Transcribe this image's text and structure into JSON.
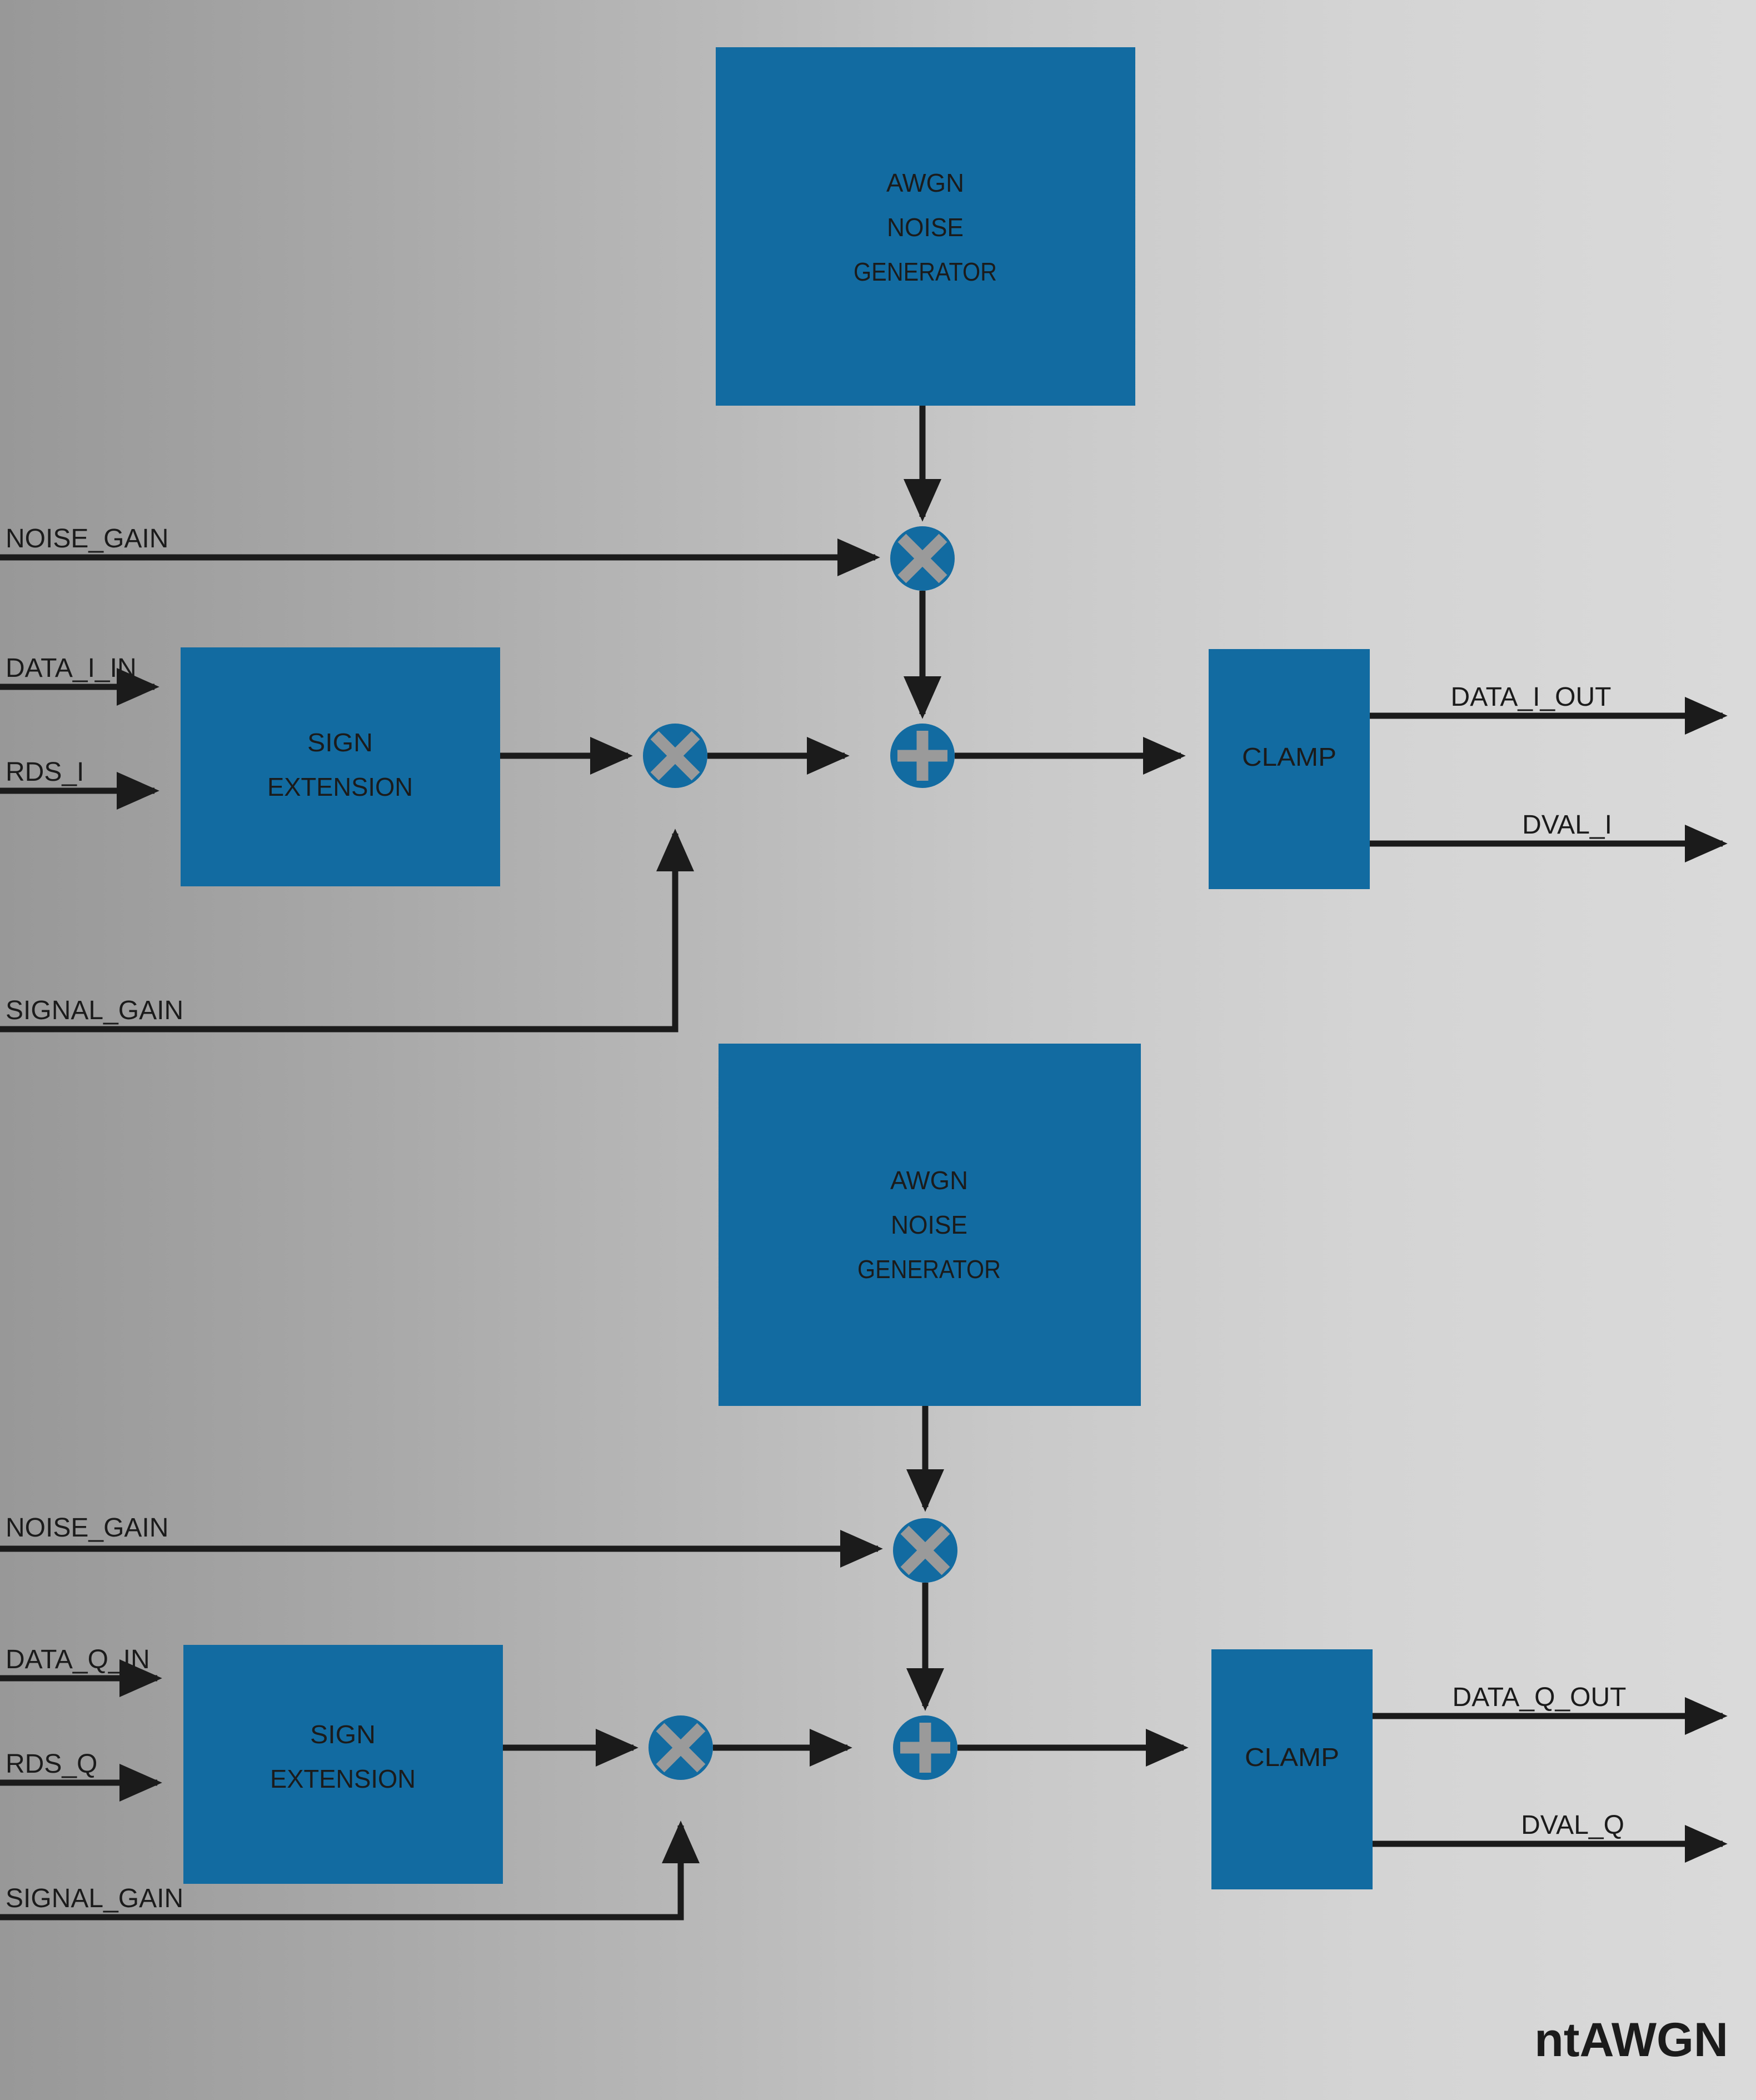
{
  "diagram": {
    "brand_label": "ntAWGN",
    "colors": {
      "block_fill": "#126ba1",
      "glyph": "#9a9a9a",
      "wire": "#1b1b1b",
      "bg_left": "#989898",
      "bg_right": "#dadada"
    },
    "channels": [
      {
        "id": "I",
        "blocks": {
          "noise_generator": {
            "line1": "AWGN",
            "line2": "NOISE",
            "line3": "GENERATOR"
          },
          "sign_extension": {
            "line1": "SIGN",
            "line2": "EXTENSION"
          },
          "clamp": {
            "label": "CLAMP"
          }
        },
        "operators": {
          "noise_multiplier": "X",
          "signal_multiplier": "X",
          "adder": "+"
        },
        "inputs": [
          {
            "name": "noise-gain-input",
            "label": "NOISE_GAIN"
          },
          {
            "name": "data-i-in-input",
            "label": "DATA_I_IN"
          },
          {
            "name": "rds-i-input",
            "label": "RDS_I"
          },
          {
            "name": "signal-gain-input",
            "label": "SIGNAL_GAIN"
          }
        ],
        "outputs": [
          {
            "name": "data-i-out-output",
            "label": "DATA_I_OUT"
          },
          {
            "name": "dval-i-output",
            "label": "DVAL_I"
          }
        ]
      },
      {
        "id": "Q",
        "blocks": {
          "noise_generator": {
            "line1": "AWGN",
            "line2": "NOISE",
            "line3": "GENERATOR"
          },
          "sign_extension": {
            "line1": "SIGN",
            "line2": "EXTENSION"
          },
          "clamp": {
            "label": "CLAMP"
          }
        },
        "operators": {
          "noise_multiplier": "X",
          "signal_multiplier": "X",
          "adder": "+"
        },
        "inputs": [
          {
            "name": "noise-gain-input",
            "label": "NOISE_GAIN"
          },
          {
            "name": "data-q-in-input",
            "label": "DATA_Q_IN"
          },
          {
            "name": "rds-q-input",
            "label": "RDS_Q"
          },
          {
            "name": "signal-gain-input",
            "label": "SIGNAL_GAIN"
          }
        ],
        "outputs": [
          {
            "name": "data-q-out-output",
            "label": "DATA_Q_OUT"
          },
          {
            "name": "dval-q-output",
            "label": "DVAL_Q"
          }
        ]
      }
    ]
  }
}
